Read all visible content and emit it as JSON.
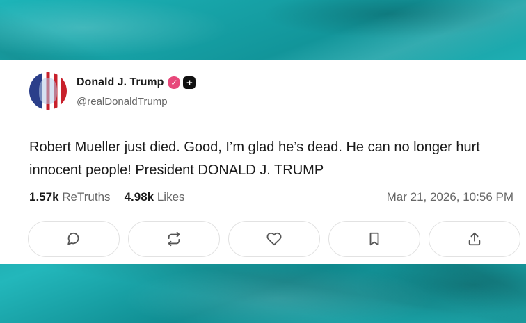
{
  "post": {
    "author_name": "Donald J. Trump",
    "author_handle": "@realDonaldTrump",
    "verified_icon": "check-badge-icon",
    "plus_icon": "plus-badge-icon",
    "text": "Robert Mueller just died. Good, I’m glad he’s dead. He can no longer hurt innocent people! President DONALD J. TRUMP",
    "retruths_count": "1.57k",
    "retruths_label": "ReTruths",
    "likes_count": "4.98k",
    "likes_label": "Likes",
    "timestamp": "Mar 21, 2026, 10:56 PM"
  },
  "actions": [
    {
      "icon": "comment-icon"
    },
    {
      "icon": "retruth-icon"
    },
    {
      "icon": "heart-icon"
    },
    {
      "icon": "bookmark-icon"
    },
    {
      "icon": "share-icon"
    }
  ],
  "colors": {
    "background": "#1aa7ab",
    "verified": "#e7487a",
    "card": "#ffffff"
  }
}
